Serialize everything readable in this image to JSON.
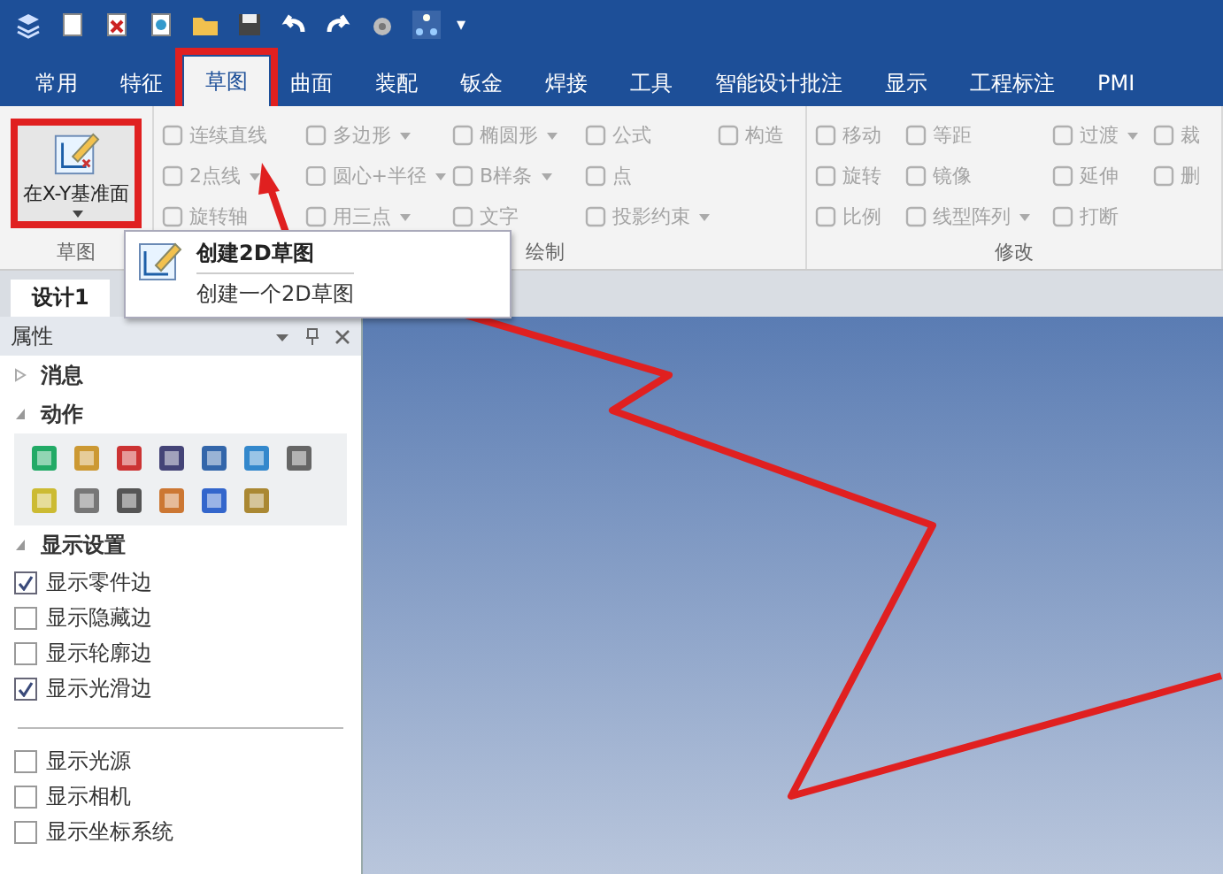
{
  "quick_access": {
    "dropdown": "▾"
  },
  "tabs": [
    {
      "label": "常用",
      "selected": false,
      "annotated": false
    },
    {
      "label": "特征",
      "selected": false,
      "annotated": false
    },
    {
      "label": "草图",
      "selected": true,
      "annotated": true
    },
    {
      "label": "曲面",
      "selected": false,
      "annotated": false
    },
    {
      "label": "装配",
      "selected": false,
      "annotated": false
    },
    {
      "label": "钣金",
      "selected": false,
      "annotated": false
    },
    {
      "label": "焊接",
      "selected": false,
      "annotated": false
    },
    {
      "label": "工具",
      "selected": false,
      "annotated": false
    },
    {
      "label": "智能设计批注",
      "selected": false,
      "annotated": false
    },
    {
      "label": "显示",
      "selected": false,
      "annotated": false
    },
    {
      "label": "工程标注",
      "selected": false,
      "annotated": false
    },
    {
      "label": "PMI",
      "selected": false,
      "annotated": false
    }
  ],
  "ribbon": {
    "groups": [
      {
        "label": "草图",
        "kind": "large",
        "button": {
          "label": "在X-Y基准面",
          "dropdown": true,
          "annotated": true
        }
      },
      {
        "label": "绘制",
        "kind": "small",
        "columns": [
          [
            {
              "label": "连续直线",
              "dropdown": false,
              "disabled": true
            },
            {
              "label": "2点线",
              "dropdown": true,
              "disabled": true
            },
            {
              "label": "旋转轴",
              "dropdown": false,
              "disabled": true
            }
          ],
          [
            {
              "label": "多边形",
              "dropdown": true,
              "disabled": true
            },
            {
              "label": "圆心+半径",
              "dropdown": true,
              "disabled": true
            },
            {
              "label": "用三点",
              "dropdown": true,
              "disabled": true
            }
          ],
          [
            {
              "label": "椭圆形",
              "dropdown": true,
              "disabled": true
            },
            {
              "label": "B样条",
              "dropdown": true,
              "disabled": true
            },
            {
              "label": "文字",
              "dropdown": false,
              "disabled": true
            }
          ],
          [
            {
              "label": "公式",
              "dropdown": false,
              "disabled": true
            },
            {
              "label": "点",
              "dropdown": false,
              "disabled": true
            },
            {
              "label": "投影约束",
              "dropdown": true,
              "disabled": true
            }
          ],
          [
            {
              "label": "构造",
              "dropdown": false,
              "disabled": true
            }
          ]
        ]
      },
      {
        "label": "修改",
        "kind": "small",
        "columns": [
          [
            {
              "label": "移动",
              "dropdown": false,
              "disabled": true
            },
            {
              "label": "旋转",
              "dropdown": false,
              "disabled": true
            },
            {
              "label": "比例",
              "dropdown": false,
              "disabled": true
            }
          ],
          [
            {
              "label": "等距",
              "dropdown": false,
              "disabled": true
            },
            {
              "label": "镜像",
              "dropdown": false,
              "disabled": true
            },
            {
              "label": "线型阵列",
              "dropdown": true,
              "disabled": true
            }
          ],
          [
            {
              "label": "过渡",
              "dropdown": true,
              "disabled": true
            },
            {
              "label": "延伸",
              "dropdown": false,
              "disabled": true
            },
            {
              "label": "打断",
              "dropdown": false,
              "disabled": true
            }
          ],
          [
            {
              "label": "裁",
              "dropdown": false,
              "disabled": true
            },
            {
              "label": "删",
              "dropdown": false,
              "disabled": true
            }
          ]
        ]
      }
    ]
  },
  "tooltip": {
    "title": "创建2D草图",
    "description": "创建一个2D草图"
  },
  "document_tabs": [
    {
      "label": "设计1",
      "selected": true
    }
  ],
  "properties_panel": {
    "title": "属性",
    "sections": [
      {
        "title": "消息",
        "expanded": false
      },
      {
        "title": "动作",
        "expanded": true,
        "kind": "icons"
      },
      {
        "title": "显示设置",
        "expanded": true,
        "kind": "checks",
        "options": [
          {
            "label": "显示零件边",
            "checked": true
          },
          {
            "label": "显示隐藏边",
            "checked": false
          },
          {
            "label": "显示轮廓边",
            "checked": false
          },
          {
            "label": "显示光滑边",
            "checked": true
          }
        ],
        "more_options": [
          {
            "label": "显示光源",
            "checked": false
          },
          {
            "label": "显示相机",
            "checked": false
          },
          {
            "label": "显示坐标系统",
            "checked": false
          }
        ]
      }
    ]
  },
  "annotations": [
    {
      "kind": "arrow"
    }
  ]
}
